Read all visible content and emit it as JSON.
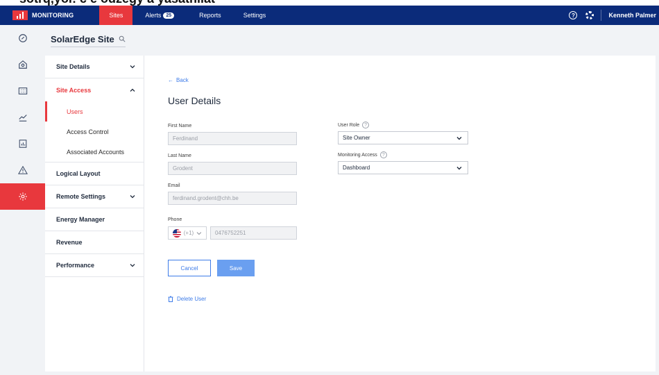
{
  "header": {
    "caption_fragment": "sotľq,yoi: c e odzegy a yasatnilat",
    "brand": "MONITORING",
    "tabs": [
      {
        "label": "Sites",
        "active": true
      },
      {
        "label": "Alerts",
        "badge": "25"
      },
      {
        "label": "Reports"
      },
      {
        "label": "Settings"
      }
    ],
    "help_glyph": "?",
    "user_name": "Kenneth Palmer",
    "colors": {
      "nav_bg": "#0b2b7a",
      "accent": "#e8383d",
      "link": "#3d7be8"
    }
  },
  "rail": {
    "icons": [
      "gauge-icon",
      "house-icon",
      "grid-icon",
      "chart-line-icon",
      "report-icon",
      "warning-icon",
      "gear-icon"
    ],
    "active_index": 6
  },
  "site": {
    "title": "SolarEdge Site"
  },
  "subnav": {
    "site_details": "Site Details",
    "site_access": "Site Access",
    "users": "Users",
    "access_control": "Access Control",
    "associated_accounts": "Associated Accounts",
    "logical_layout": "Logical Layout",
    "remote_settings": "Remote Settings",
    "energy_manager": "Energy Manager",
    "revenue": "Revenue",
    "performance": "Performance"
  },
  "form": {
    "back": "Back",
    "title": "User Details",
    "first_name_label": "First Name",
    "first_name": "Ferdinand",
    "last_name_label": "Last Name",
    "last_name": "Grodent",
    "email_label": "Email",
    "email": "ferdinand.grodent@chh.be",
    "phone_label": "Phone",
    "phone_code": "(+1)",
    "phone": "0476752251",
    "user_role_label": "User Role",
    "user_role": "Site Owner",
    "monitoring_access_label": "Monitoring Access",
    "monitoring_access": "Dashboard",
    "cancel": "Cancel",
    "save": "Save",
    "delete_user": "Delete User"
  }
}
